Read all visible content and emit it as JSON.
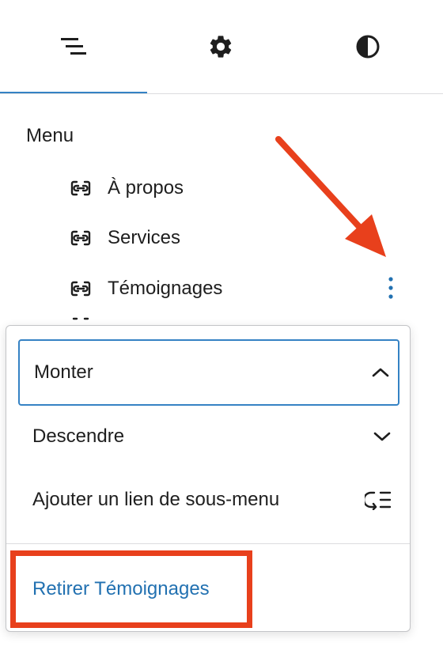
{
  "tabs": [
    {
      "name": "list-view",
      "icon": "list-view-icon",
      "active": true
    },
    {
      "name": "settings",
      "icon": "gear-icon",
      "active": false
    },
    {
      "name": "styles",
      "icon": "half-circle-contrast-icon",
      "active": false
    }
  ],
  "menu": {
    "title": "Menu",
    "items": [
      {
        "label": "À propos",
        "icon": "link-block-icon"
      },
      {
        "label": "Services",
        "icon": "link-block-icon"
      },
      {
        "label": "Témoignages",
        "icon": "link-block-icon"
      }
    ]
  },
  "options_icon": "vertical-ellipsis-icon",
  "dropdown": {
    "move_up": "Monter",
    "move_down": "Descendre",
    "add_submenu": "Ajouter un lien de sous-menu",
    "remove": "Retirer Témoignages"
  },
  "colors": {
    "accent": "#3582c4",
    "link": "#2271b1",
    "annotation": "#e8401c"
  }
}
